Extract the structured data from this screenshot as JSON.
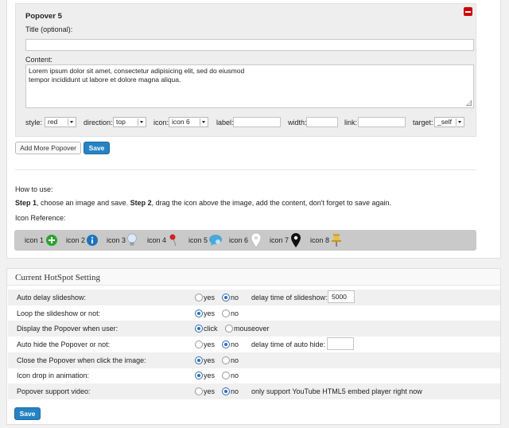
{
  "popover": {
    "title": "Popover 5",
    "title_label": "Title (optional):",
    "title_value": "",
    "content_label": "Content:",
    "content_line1": "Lorem ipsum dolor sit amet, consectetur adipisicing elit, sed do eiusmod",
    "content_line2": "tempor incididunt ut labore et dolore magna aliqua.",
    "controls": {
      "style_label": "style:",
      "style_value": "red",
      "direction_label": "direction:",
      "direction_value": "top",
      "icon_label": "icon:",
      "icon_value": "icon 6",
      "label_label": "label:",
      "label_value": "",
      "width_label": "width:",
      "width_value": "",
      "link_label": "link:",
      "link_value": "",
      "target_label": "target:",
      "target_value": "_self"
    }
  },
  "actions": {
    "add_more_label": "Add More Popover",
    "save_label": "Save"
  },
  "howto": {
    "heading": "How to use:",
    "step1_bold": "Step 1",
    "step1_text": ", choose an image and save. ",
    "step2_bold": "Step 2",
    "step2_text": ", drag the icon above the image, add the content, don't forget to save again.",
    "icon_reference_label": "Icon Reference:"
  },
  "icons": [
    {
      "label": "icon 1",
      "icon": "green-plus-icon",
      "color": "#2aa52a"
    },
    {
      "label": "icon 2",
      "icon": "blue-info-icon",
      "color": "#1e73be"
    },
    {
      "label": "icon 3",
      "icon": "lightbulb-icon",
      "color": "#bcd3ea"
    },
    {
      "label": "icon 4",
      "icon": "red-pin-icon",
      "color": "#d42020"
    },
    {
      "label": "icon 5",
      "icon": "speech-bubble-icon",
      "color": "#4aa8d8"
    },
    {
      "label": "icon 6",
      "icon": "white-map-marker-icon",
      "color": "#ffffff"
    },
    {
      "label": "icon 7",
      "icon": "black-map-marker-icon",
      "color": "#111111"
    },
    {
      "label": "icon 8",
      "icon": "pushpin-icon",
      "color": "#d4a72c"
    }
  ],
  "settings": {
    "title": "Current HotSpot Setting",
    "yes": "yes",
    "no": "no",
    "rows": [
      {
        "label": "Auto delay slideshow:",
        "selected": "no",
        "extra_label": "delay time of slideshow:",
        "extra_value": "5000"
      },
      {
        "label": "Loop the slideshow or not:",
        "selected": "yes"
      },
      {
        "label": "Display the Popover when user:",
        "opt1": "click",
        "opt2": "mouseover",
        "selected": "click"
      },
      {
        "label": "Auto hide the Popover or not:",
        "selected": "no",
        "extra_label": "delay time of auto hide:",
        "extra_value": ""
      },
      {
        "label": "Close the Popover when click the image:",
        "selected": "yes"
      },
      {
        "label": "Icon drop in animation:",
        "selected": "yes"
      },
      {
        "label": "Popover support video:",
        "selected": "no",
        "note": "only support YouTube HTML5 embed player right now"
      }
    ],
    "save_label": "Save"
  }
}
